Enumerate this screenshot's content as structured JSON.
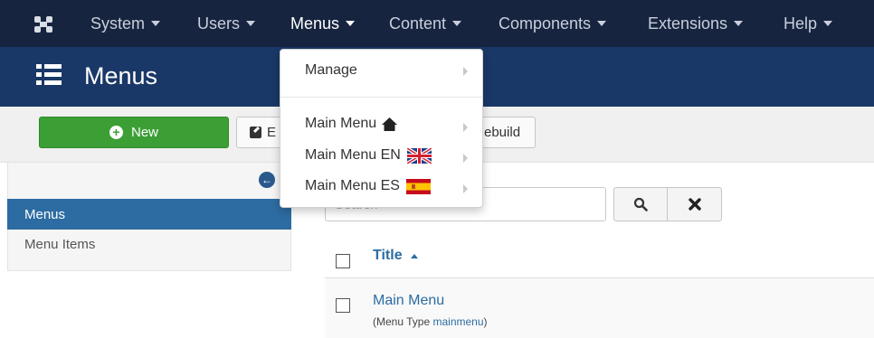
{
  "navbar": {
    "logo_icon": "joomla-logo-icon",
    "items": [
      {
        "label": "System"
      },
      {
        "label": "Users"
      },
      {
        "label": "Menus"
      },
      {
        "label": "Content"
      },
      {
        "label": "Components"
      },
      {
        "label": "Extensions"
      },
      {
        "label": "Help"
      }
    ]
  },
  "header": {
    "title": "Menus",
    "icon": "list-icon"
  },
  "toolbar": {
    "new_label": "New",
    "edit_label": "E",
    "rebuild_label": "ebuild"
  },
  "sidebar": {
    "active_label": "Menus",
    "items": [
      {
        "label": "Menu Items"
      }
    ]
  },
  "search": {
    "placeholder": "Search"
  },
  "table": {
    "column_title": "Title",
    "rows": [
      {
        "title": "Main Menu",
        "menu_type_label": "(Menu Type ",
        "menu_type_code": "mainmenu",
        "menu_type_close": ")"
      }
    ]
  },
  "dropdown": {
    "items": [
      {
        "label": "Manage"
      },
      {
        "label": "Main Menu"
      },
      {
        "label": "Main Menu EN"
      },
      {
        "label": "Main Menu ES"
      }
    ]
  },
  "colors": {
    "navbar": "#16243f",
    "titlebar": "#1a3867",
    "accent": "#2d6ca2",
    "success": "#3c9f36"
  }
}
